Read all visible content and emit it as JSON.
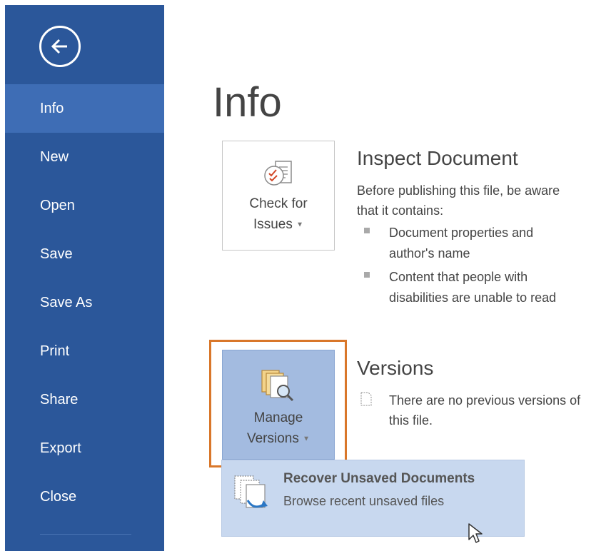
{
  "sidebar": {
    "items": [
      {
        "label": "Info"
      },
      {
        "label": "New"
      },
      {
        "label": "Open"
      },
      {
        "label": "Save"
      },
      {
        "label": "Save As"
      },
      {
        "label": "Print"
      },
      {
        "label": "Share"
      },
      {
        "label": "Export"
      },
      {
        "label": "Close"
      }
    ],
    "selected": "Info"
  },
  "main": {
    "title": "Info",
    "inspect": {
      "button_line1": "Check for",
      "button_line2": "Issues",
      "title": "Inspect Document",
      "desc_line1": "Before publishing this file, be aware",
      "desc_line2": "that it contains:",
      "bullets": [
        {
          "line1": "Document properties and",
          "line2": "author's name"
        },
        {
          "line1": "Content that people with",
          "line2": "disabilities are unable to read"
        }
      ]
    },
    "versions": {
      "button_line1": "Manage",
      "button_line2": "Versions",
      "title": "Versions",
      "desc_line1": "There are no previous versions of",
      "desc_line2": "this file."
    },
    "dropdown": {
      "title": "Recover Unsaved Documents",
      "subtitle": "Browse recent unsaved files"
    }
  },
  "colors": {
    "sidebar": "#2b579a",
    "sidebar_selected": "#3e6db5",
    "highlight": "#d9772a",
    "button_active": "#a3bbe0",
    "dropdown": "#c8d8ef"
  },
  "icons": {
    "back": "back-arrow-icon",
    "check_issues": "inspect-document-icon",
    "manage_versions": "versions-magnifier-icon",
    "version_note": "document-outline-icon",
    "recover": "recover-documents-icon",
    "cursor": "mouse-pointer-icon"
  }
}
